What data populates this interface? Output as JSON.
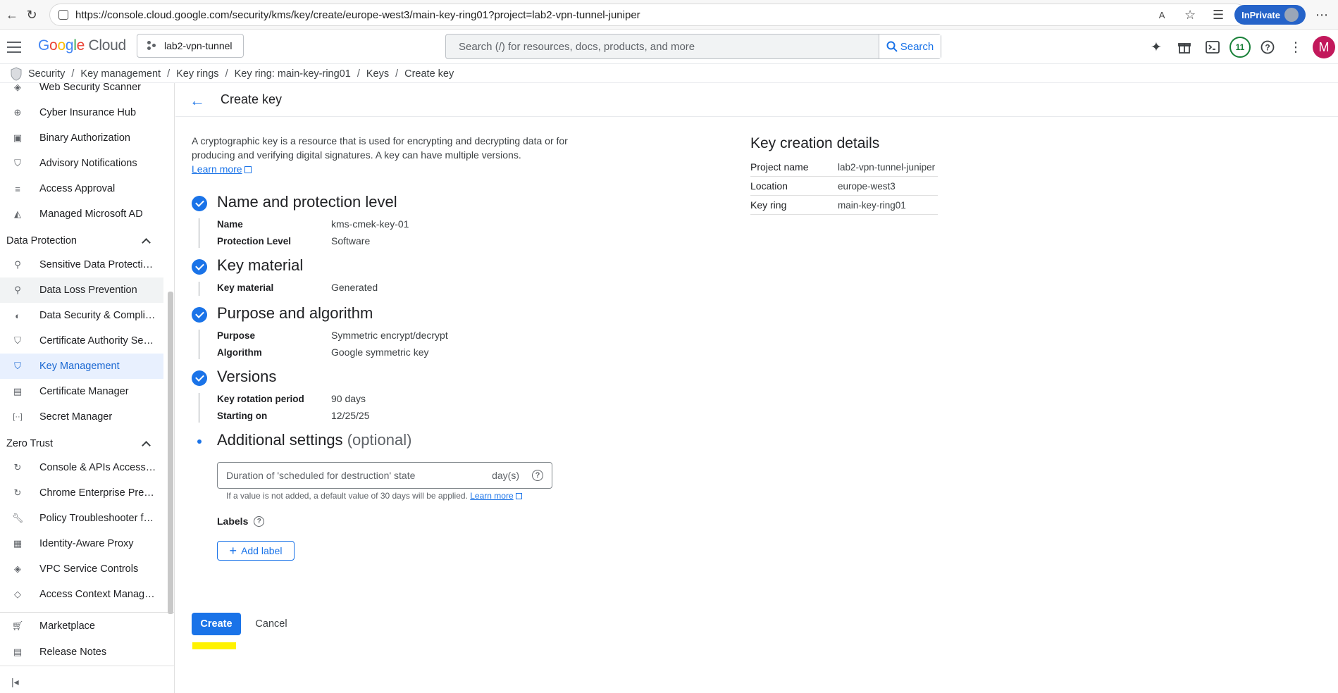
{
  "browser": {
    "url": "https://console.cloud.google.com/security/kms/key/create/europe-west3/main-key-ring01?project=lab2-vpn-tunnel-juniper",
    "inprivate_label": "InPrivate"
  },
  "header": {
    "logo_google": [
      "G",
      "o",
      "o",
      "g",
      "l",
      "e"
    ],
    "logo_cloud": "Cloud",
    "project": "lab2-vpn-tunnel",
    "search_placeholder": "Search (/) for resources, docs, products, and more",
    "search_button": "Search",
    "notifications_count": "11",
    "avatar_initial": "M"
  },
  "breadcrumb": [
    "Security",
    "Key management",
    "Key rings",
    "Key ring: main-key-ring01",
    "Keys",
    "Create key"
  ],
  "sidebar": {
    "items_top": [
      {
        "label": "Web Security Scanner",
        "icon": "scanner-icon"
      },
      {
        "label": "Cyber Insurance Hub",
        "icon": "globe-icon"
      },
      {
        "label": "Binary Authorization",
        "icon": "badge-icon"
      },
      {
        "label": "Advisory Notifications",
        "icon": "shield-icon"
      },
      {
        "label": "Access Approval",
        "icon": "approval-icon"
      },
      {
        "label": "Managed Microsoft AD",
        "icon": "ad-icon"
      }
    ],
    "section_data_protection": "Data Protection",
    "items_dp": [
      {
        "label": "Sensitive Data Protecti…",
        "icon": "search-icon"
      },
      {
        "label": "Data Loss Prevention",
        "icon": "search-icon"
      },
      {
        "label": "Data Security & Compli…",
        "icon": "shield-icon"
      },
      {
        "label": "Certificate Authority Se…",
        "icon": "shield-icon"
      },
      {
        "label": "Key Management",
        "icon": "shield-key-icon"
      },
      {
        "label": "Certificate Manager",
        "icon": "certificate-icon"
      },
      {
        "label": "Secret Manager",
        "icon": "secret-icon"
      }
    ],
    "section_zero_trust": "Zero Trust",
    "items_zt": [
      {
        "label": "Console & APIs Access…",
        "icon": "refresh-icon"
      },
      {
        "label": "Chrome Enterprise Pre…",
        "icon": "refresh-icon"
      },
      {
        "label": "Policy Troubleshooter f…",
        "icon": "wrench-icon"
      },
      {
        "label": "Identity-Aware Proxy",
        "icon": "proxy-icon"
      },
      {
        "label": "VPC Service Controls",
        "icon": "vpc-icon"
      },
      {
        "label": "Access Context Manag…",
        "icon": "diamond-icon"
      }
    ],
    "marketplace": "Marketplace",
    "release_notes": "Release Notes"
  },
  "main": {
    "title": "Create key",
    "intro": "A cryptographic key is a resource that is used for encrypting and decrypting data or for producing and verifying digital signatures. A key can have multiple versions.",
    "learn_more": "Learn more",
    "steps": {
      "name": {
        "title": "Name and protection level",
        "rows": [
          {
            "k": "Name",
            "v": "kms-cmek-key-01"
          },
          {
            "k": "Protection Level",
            "v": "Software"
          }
        ]
      },
      "material": {
        "title": "Key material",
        "rows": [
          {
            "k": "Key material",
            "v": "Generated"
          }
        ]
      },
      "purpose": {
        "title": "Purpose and algorithm",
        "rows": [
          {
            "k": "Purpose",
            "v": "Symmetric encrypt/decrypt"
          },
          {
            "k": "Algorithm",
            "v": "Google symmetric key"
          }
        ]
      },
      "versions": {
        "title": "Versions",
        "rows": [
          {
            "k": "Key rotation period",
            "v": "90 days"
          },
          {
            "k": "Starting on",
            "v": "12/25/25"
          }
        ]
      },
      "additional": {
        "title": "Additional settings",
        "optional": "(optional)"
      }
    },
    "duration_placeholder": "Duration of 'scheduled for destruction' state",
    "duration_unit": "day(s)",
    "hint": "If a value is not added, a default value of 30 days will be applied.",
    "hint_link": "Learn more",
    "labels": "Labels",
    "add_label": "Add label",
    "create": "Create",
    "cancel": "Cancel"
  },
  "details": {
    "title": "Key creation details",
    "rows": [
      {
        "k": "Project name",
        "v": "lab2-vpn-tunnel-juniper"
      },
      {
        "k": "Location",
        "v": "europe-west3"
      },
      {
        "k": "Key ring",
        "v": "main-key-ring01"
      }
    ]
  },
  "colors": {
    "accent": "#1a73e8",
    "highlight": "#fff200"
  }
}
